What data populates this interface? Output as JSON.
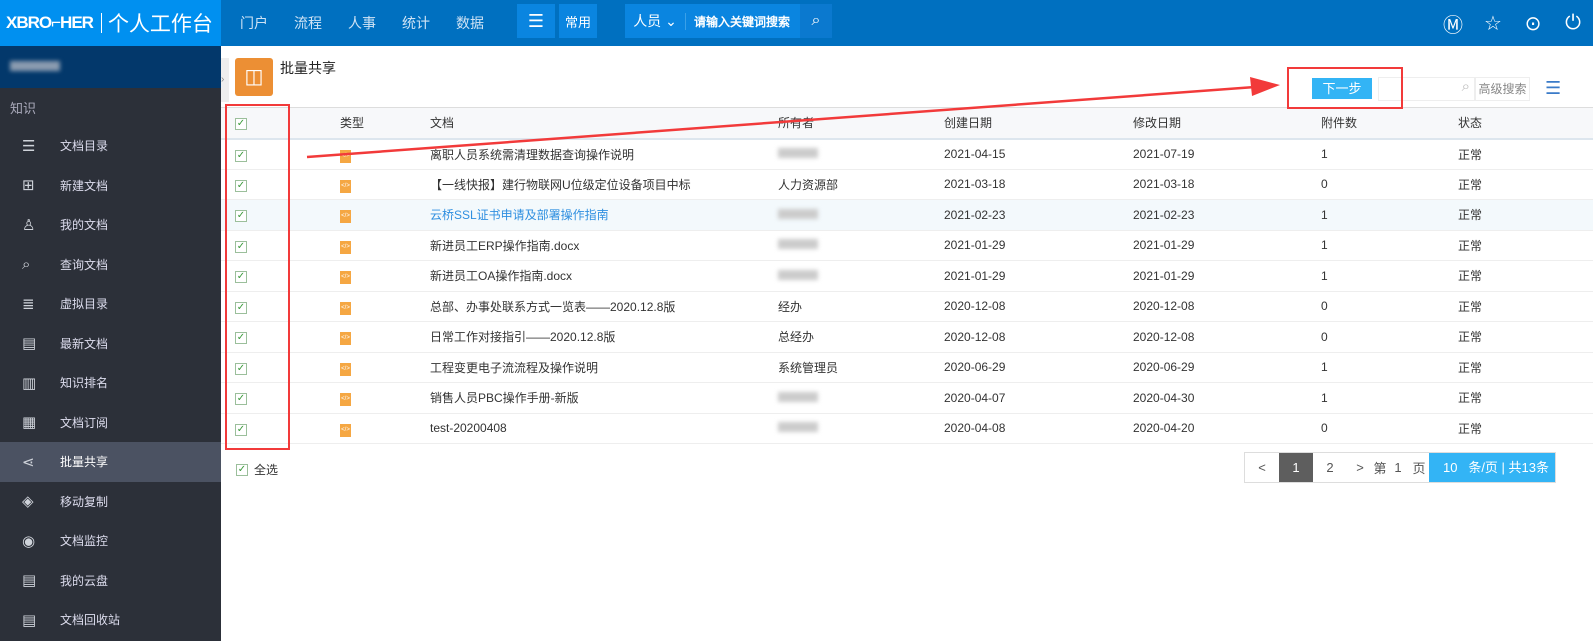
{
  "header": {
    "brand": "XBRO⌐HER",
    "workspace": "个人工作台",
    "nav": [
      "门户",
      "流程",
      "人事",
      "统计",
      "数据"
    ],
    "menu_icon": "menu-icon",
    "common": "常用",
    "search_scope": "人员",
    "search_placeholder": "请输入关键词搜索",
    "right_icons": [
      "m-icon",
      "star-icon",
      "more-icon",
      "power-icon"
    ]
  },
  "sidebar": {
    "section": "知识",
    "items": [
      {
        "label": "文档目录",
        "icon": "☰"
      },
      {
        "label": "新建文档",
        "icon": "⊞"
      },
      {
        "label": "我的文档",
        "icon": "♙"
      },
      {
        "label": "查询文档",
        "icon": "⌕"
      },
      {
        "label": "虚拟目录",
        "icon": "≣"
      },
      {
        "label": "最新文档",
        "icon": "▤"
      },
      {
        "label": "知识排名",
        "icon": "▥"
      },
      {
        "label": "文档订阅",
        "icon": "▦"
      },
      {
        "label": "批量共享",
        "icon": "⋖"
      },
      {
        "label": "移动复制",
        "icon": "◈"
      },
      {
        "label": "文档监控",
        "icon": "◉"
      },
      {
        "label": "我的云盘",
        "icon": "▤"
      },
      {
        "label": "文档回收站",
        "icon": "▤"
      }
    ],
    "active": "批量共享"
  },
  "page": {
    "title": "批量共享",
    "next_label": "下一步",
    "advanced_search": "高级搜索"
  },
  "table": {
    "columns": [
      "类型",
      "文档",
      "所有者",
      "创建日期",
      "修改日期",
      "附件数",
      "状态"
    ],
    "rows": [
      {
        "doc": "离职人员系统需清理数据查询操作说明",
        "owner": "",
        "created": "2021-04-15",
        "modified": "2021-07-19",
        "attachments": "1",
        "status": "正常"
      },
      {
        "doc": "【一线快报】建行物联网U位级定位设备项目中标",
        "owner": "人力资源部",
        "created": "2021-03-18",
        "modified": "2021-03-18",
        "attachments": "0",
        "status": "正常"
      },
      {
        "doc": "云桥SSL证书申请及部署操作指南",
        "owner": "",
        "created": "2021-02-23",
        "modified": "2021-02-23",
        "attachments": "1",
        "status": "正常"
      },
      {
        "doc": "新进员工ERP操作指南.docx",
        "owner": "",
        "created": "2021-01-29",
        "modified": "2021-01-29",
        "attachments": "1",
        "status": "正常"
      },
      {
        "doc": "新进员工OA操作指南.docx",
        "owner": "",
        "created": "2021-01-29",
        "modified": "2021-01-29",
        "attachments": "1",
        "status": "正常"
      },
      {
        "doc": "总部、办事处联系方式一览表——2020.12.8版",
        "owner": "经办",
        "created": "2020-12-08",
        "modified": "2020-12-08",
        "attachments": "0",
        "status": "正常"
      },
      {
        "doc": "日常工作对接指引——2020.12.8版",
        "owner": "总经办",
        "created": "2020-12-08",
        "modified": "2020-12-08",
        "attachments": "0",
        "status": "正常"
      },
      {
        "doc": "工程变更电子流流程及操作说明",
        "owner": "系统管理员",
        "created": "2020-06-29",
        "modified": "2020-06-29",
        "attachments": "1",
        "status": "正常"
      },
      {
        "doc": "销售人员PBC操作手册-新版",
        "owner": "",
        "created": "2020-04-07",
        "modified": "2020-04-30",
        "attachments": "1",
        "status": "正常"
      },
      {
        "doc": "test-20200408",
        "owner": "",
        "created": "2020-04-08",
        "modified": "2020-04-20",
        "attachments": "0",
        "status": "正常"
      }
    ]
  },
  "footer": {
    "select_all": "全选",
    "prev": "<",
    "pages": [
      "1",
      "2"
    ],
    "current_page": "1",
    "next": ">",
    "page_prefix": "第",
    "page_value": "1",
    "page_suffix": "页",
    "page_size": "10",
    "page_size_suffix": "条/页 | 共13条"
  },
  "colors": {
    "header": "#0070c0",
    "logo_bg": "#0090f0",
    "sidebar": "#2c3039",
    "accent": "#33b4f5",
    "annotation": "#f23a3a"
  }
}
